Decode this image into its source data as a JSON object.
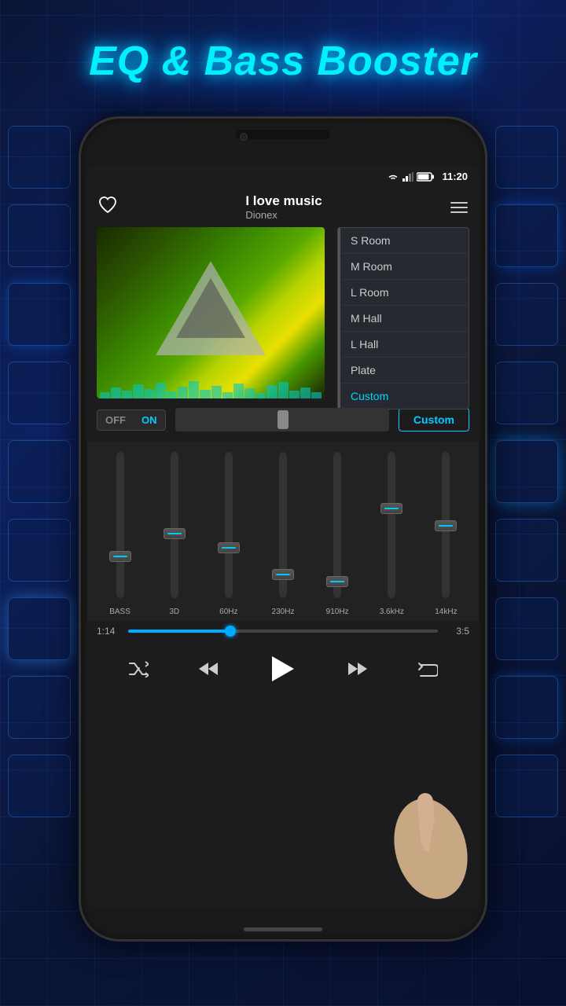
{
  "app": {
    "title": "EQ & Bass Booster"
  },
  "status_bar": {
    "time": "11:20"
  },
  "song": {
    "title": "I love music",
    "artist": "Dionex"
  },
  "toggle": {
    "off_label": "OFF",
    "on_label": "ON"
  },
  "custom_button": {
    "label": "Custom"
  },
  "eq_presets": [
    {
      "label": "S Room",
      "active": false
    },
    {
      "label": "M Room",
      "active": false
    },
    {
      "label": "L Room",
      "active": false
    },
    {
      "label": "M Hall",
      "active": false
    },
    {
      "label": "L Hall",
      "active": false
    },
    {
      "label": "Plate",
      "active": false
    },
    {
      "label": "Custom",
      "active": true
    }
  ],
  "eq_bands": [
    {
      "label": "BASS",
      "position": 72
    },
    {
      "label": "3D",
      "position": 55
    },
    {
      "label": "60Hz",
      "position": 65
    },
    {
      "label": "230Hz",
      "position": 82
    },
    {
      "label": "910Hz",
      "position": 88
    },
    {
      "label": "3.6kHz",
      "position": 40
    },
    {
      "label": "14kHz",
      "position": 50
    }
  ],
  "progress": {
    "current": "1:14",
    "total": "3:5",
    "percent": 33
  },
  "controls": {
    "shuffle_label": "shuffle",
    "rewind_label": "rewind",
    "play_label": "play",
    "forward_label": "forward",
    "repeat_label": "repeat"
  },
  "colors": {
    "accent": "#00ccff",
    "background": "#1c1c1e",
    "surface": "#2a2a2a"
  }
}
